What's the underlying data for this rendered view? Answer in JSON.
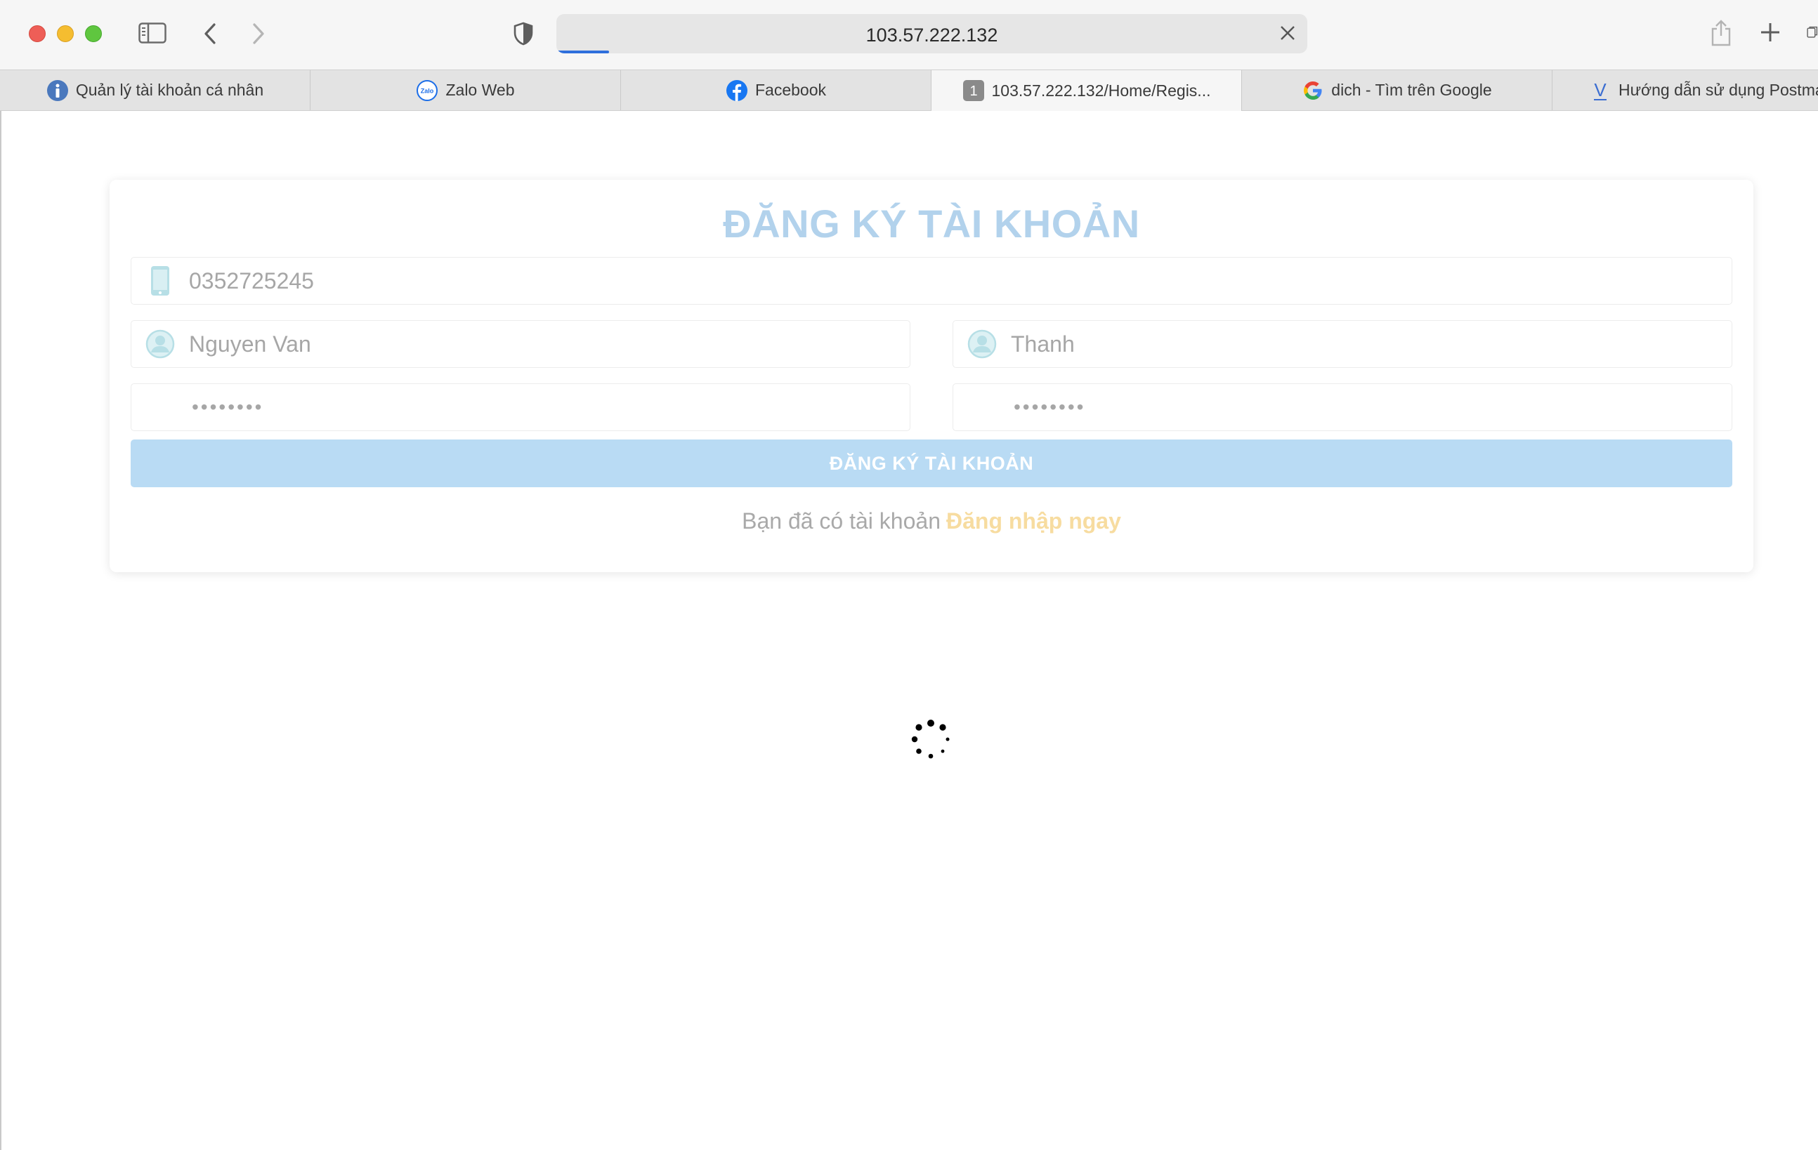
{
  "browser": {
    "url": "103.57.222.132",
    "load_progress": 0.07
  },
  "tabs": [
    {
      "label": "Quản lý tài khoản cá nhân",
      "favicon": "info-icon",
      "active": false
    },
    {
      "label": "Zalo Web",
      "favicon": "zalo-icon",
      "favicon_text": "Zalo",
      "active": false
    },
    {
      "label": "Facebook",
      "favicon": "facebook-icon",
      "active": false
    },
    {
      "label": "103.57.222.132/Home/Regis...",
      "favicon": "number-icon",
      "favicon_text": "1",
      "active": true
    },
    {
      "label": "dich - Tìm trên Google",
      "favicon": "google-icon",
      "active": false
    },
    {
      "label": "Hướng dẫn sử dụng Postma...",
      "favicon": "v-icon",
      "favicon_text": "V",
      "active": false
    }
  ],
  "form": {
    "title": "ĐĂNG KÝ TÀI KHOẢN",
    "phone": "0352725245",
    "last_name": "Nguyen Van",
    "first_name": "Thanh",
    "password": "••••••••",
    "confirm_password": "••••••••",
    "submit_label": "ĐĂNG KÝ TÀI KHOẢN",
    "login_prefix": "Bạn đã có tài khoản",
    "login_link": "Đăng nhập ngay"
  },
  "colors": {
    "title": "#b2d2ec",
    "button": "#b9dbf4",
    "link": "#f7dca0",
    "input_icon": "#b7dfe6"
  }
}
